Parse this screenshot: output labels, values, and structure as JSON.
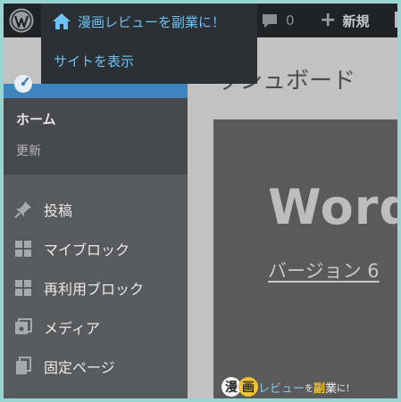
{
  "adminbar": {
    "comment_count": "0",
    "new_label": "新規"
  },
  "site_menu": {
    "site_name": "漫画レビューを副業に！",
    "view_site": "サイトを表示"
  },
  "sidebar": {
    "dashboard_submenu": {
      "home": "ホーム",
      "update": "更新"
    },
    "items": [
      {
        "label": "投稿",
        "icon": "pin-icon"
      },
      {
        "label": "マイブロック",
        "icon": "grid-icon"
      },
      {
        "label": "再利用ブロック",
        "icon": "grid-icon"
      },
      {
        "label": "メディア",
        "icon": "media-icon"
      },
      {
        "label": "固定ページ",
        "icon": "pages-icon"
      }
    ]
  },
  "main": {
    "page_title": "ッシュボード",
    "welcome_title": "Word",
    "version_link": "バージョン 6"
  },
  "watermark": {
    "c1": "漫",
    "c2": "画",
    "part1": "レビュー",
    "part2": "を",
    "part3": "副",
    "part4": "業",
    "part5": "に！"
  },
  "colors": {
    "accent": "#3e85bf",
    "link": "#6fc0f2",
    "adminbar_bg": "#1f2326",
    "sidebar_bg": "#585b5e"
  }
}
